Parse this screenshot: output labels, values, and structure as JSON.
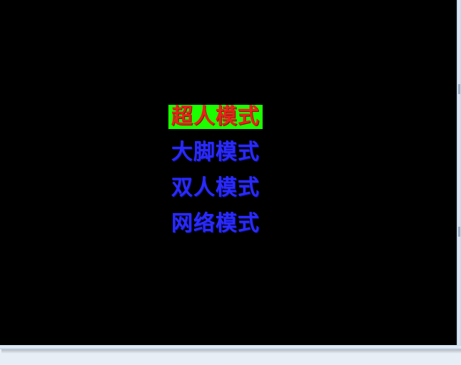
{
  "menu": {
    "items": [
      {
        "label": "超人模式",
        "selected": true
      },
      {
        "label": "大脚模式",
        "selected": false
      },
      {
        "label": "双人模式",
        "selected": false
      },
      {
        "label": "网络模式",
        "selected": false
      }
    ]
  },
  "colors": {
    "background": "#000000",
    "selected_highlight": "#1cff00",
    "selected_text": "#e8221a",
    "item_text": "#2a2aff",
    "window_frame": "#dfeaf6"
  }
}
